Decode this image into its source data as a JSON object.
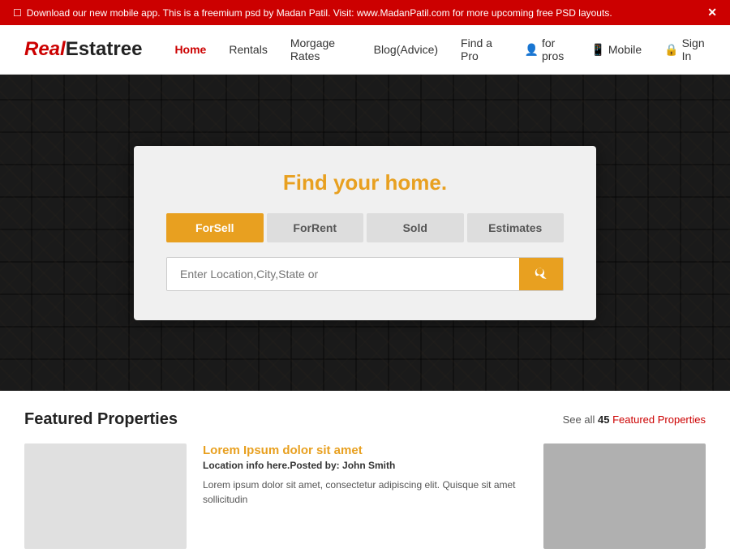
{
  "notif": {
    "text": "Download our new mobile app. This is a freemium psd by Madan Patil. Visit: www.MadanPatil.com for more upcoming free PSD layouts.",
    "close": "✕",
    "phone_icon": "☐"
  },
  "header": {
    "logo_real": "Real",
    "logo_estatree": "Estatree",
    "nav": [
      {
        "label": "Home",
        "active": true
      },
      {
        "label": "Rentals"
      },
      {
        "label": "Morgage Rates"
      },
      {
        "label": "Blog(Advice)"
      },
      {
        "label": "Find a Pro"
      },
      {
        "label": "for pros",
        "icon": "person"
      },
      {
        "label": "Mobile",
        "icon": "phone"
      },
      {
        "label": "Sign In",
        "icon": "lock"
      }
    ]
  },
  "hero": {
    "search_card": {
      "title": "Find your home.",
      "tabs": [
        {
          "label": "ForSell",
          "active": true
        },
        {
          "label": "ForRent"
        },
        {
          "label": "Sold"
        },
        {
          "label": "Estimates"
        }
      ],
      "input_placeholder": "Enter Location,City,State or",
      "search_btn_label": "Search"
    }
  },
  "featured": {
    "section_title": "Featured Properties",
    "see_all_prefix": "See all",
    "count": "45",
    "see_all_suffix": "Featured Properties",
    "property": {
      "title": "Lorem Ipsum dolor sit amet",
      "meta": "Location info here.Posted by: John Smith",
      "desc": "Lorem ipsum dolor sit amet, consectetur adipiscing elit. Quisque sit amet sollicitudin"
    }
  }
}
